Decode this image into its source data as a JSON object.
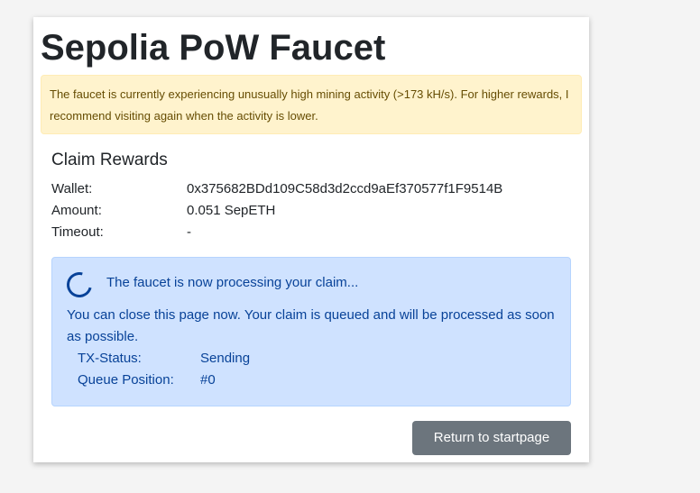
{
  "page": {
    "title": "Sepolia PoW Faucet",
    "warning": "The faucet is currently experiencing unusually high mining activity (>173 kH/s). For higher rewards, I recommend visiting again when the activity is lower."
  },
  "claim": {
    "heading": "Claim Rewards",
    "wallet_label": "Wallet:",
    "wallet_value": "0x375682BDd109C58d3d2ccd9aEf370577f1F9514B",
    "amount_label": "Amount:",
    "amount_value": "0.051 SepETH",
    "timeout_label": "Timeout:",
    "timeout_value": "-"
  },
  "processing": {
    "title": "The faucet is now processing your claim...",
    "message": "You can close this page now. Your claim is queued and will be processed as soon as possible.",
    "tx_status_label": "TX-Status:",
    "tx_status_value": "Sending",
    "queue_label": "Queue Position:",
    "queue_value": "#0"
  },
  "actions": {
    "return_label": "Return to startpage"
  },
  "colors": {
    "warning_bg": "#fff3cd",
    "warning_text": "#664d03",
    "info_bg": "#cfe2ff",
    "info_text": "#084298",
    "button_bg": "#6c757d"
  },
  "icons": {
    "spinner": "loading-spinner-icon"
  }
}
